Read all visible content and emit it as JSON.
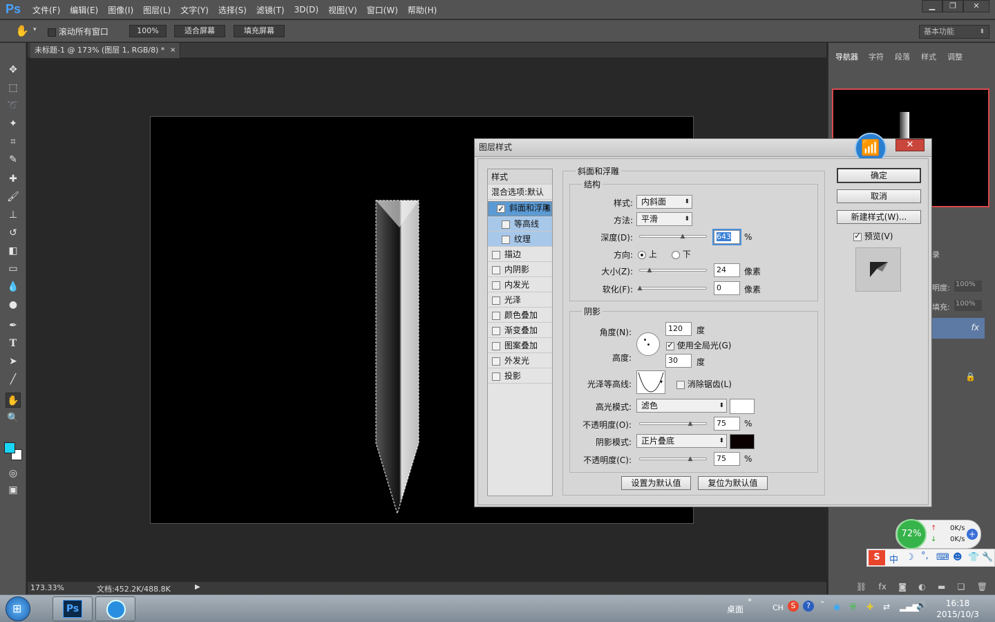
{
  "app": {
    "logo": "Ps"
  },
  "menu": [
    "文件(F)",
    "编辑(E)",
    "图像(I)",
    "图层(L)",
    "文字(Y)",
    "选择(S)",
    "滤镜(T)",
    "3D(D)",
    "视图(V)",
    "窗口(W)",
    "帮助(H)"
  ],
  "options": {
    "scroll_all": "滚动所有窗口",
    "zoom_100": "100%",
    "fit_screen": "适合屏幕",
    "fill_screen": "填充屏幕",
    "workspace": "基本功能"
  },
  "document": {
    "tab_title": "未标题-1 @ 173% (图层 1, RGB/8) *",
    "zoom": "173.33%",
    "doc_size": "文档:452.2K/488.8K"
  },
  "panels": {
    "tabs": [
      "导航器",
      "字符",
      "段落",
      "样式",
      "调整"
    ],
    "layers_opacity_label": "明度:",
    "layers_opacity": "100%",
    "layers_fill_label": "填充:",
    "layers_fill": "100%",
    "history_partial": "录"
  },
  "dialog": {
    "title": "图层样式",
    "styles_header": "样式",
    "blend_options": "混合选项:默认",
    "style_items": [
      {
        "label": "斜面和浮雕",
        "checked": true
      },
      {
        "label": "等高线",
        "checked": false
      },
      {
        "label": "纹理",
        "checked": false
      },
      {
        "label": "描边",
        "checked": false
      },
      {
        "label": "内阴影",
        "checked": false
      },
      {
        "label": "内发光",
        "checked": false
      },
      {
        "label": "光泽",
        "checked": false
      },
      {
        "label": "颜色叠加",
        "checked": false
      },
      {
        "label": "渐变叠加",
        "checked": false
      },
      {
        "label": "图案叠加",
        "checked": false
      },
      {
        "label": "外发光",
        "checked": false
      },
      {
        "label": "投影",
        "checked": false
      }
    ],
    "section_title": "斜面和浮雕",
    "structure": {
      "title": "结构",
      "style_label": "样式:",
      "style_value": "内斜面",
      "technique_label": "方法:",
      "technique_value": "平滑",
      "depth_label": "深度(D):",
      "depth_value": "643",
      "depth_unit": "%",
      "direction_label": "方向:",
      "direction_up": "上",
      "direction_down": "下",
      "size_label": "大小(Z):",
      "size_value": "24",
      "size_unit": "像素",
      "soften_label": "软化(F):",
      "soften_value": "0",
      "soften_unit": "像素"
    },
    "shading": {
      "title": "阴影",
      "angle_label": "角度(N):",
      "angle_value": "120",
      "angle_unit": "度",
      "global_light": "使用全局光(G)",
      "altitude_label": "高度:",
      "altitude_value": "30",
      "altitude_unit": "度",
      "gloss_label": "光泽等高线:",
      "anti_alias": "消除锯齿(L)",
      "highlight_label": "高光模式:",
      "highlight_value": "滤色",
      "highlight_color": "#ffffff",
      "hl_opacity_label": "不透明度(O):",
      "hl_opacity_value": "75",
      "shadow_label": "阴影模式:",
      "shadow_value": "正片叠底",
      "shadow_color": "#0a0000",
      "sh_opacity_label": "不透明度(C):",
      "sh_opacity_value": "75",
      "pct": "%"
    },
    "make_default": "设置为默认值",
    "reset_default": "复位为默认值",
    "ok": "确定",
    "cancel": "取消",
    "new_style": "新建样式(W)...",
    "preview": "预览(V)"
  },
  "tray": {
    "net_percent": "72%",
    "up_speed": "0K/s",
    "down_speed": "0K/s",
    "ime": "中",
    "desktop": "桌面",
    "lang": "CH",
    "time": "16:18",
    "date": "2015/10/3"
  },
  "colors": {
    "foreground": "#1ad5f5",
    "background": "#ffffff",
    "accent": "#5b9bd5"
  }
}
